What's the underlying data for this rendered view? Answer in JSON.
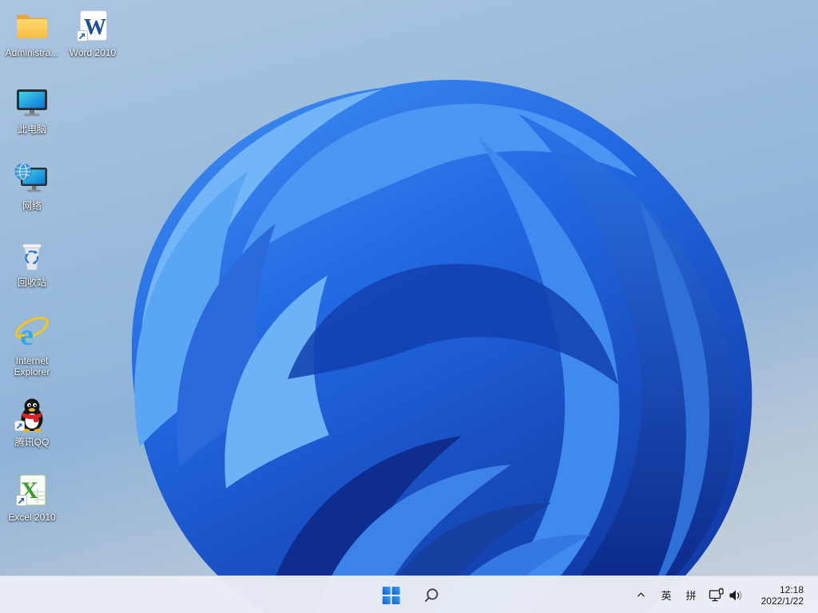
{
  "wallpaper": {
    "name": "windows-11-bloom",
    "bloom_primary": "#2268e2",
    "bloom_dark": "#0a2584",
    "bloom_light": "#72b5f8",
    "background_sky": "#9cbcdc"
  },
  "desktop": {
    "icons": [
      {
        "name": "administrator-folder",
        "label": "Administra..."
      },
      {
        "name": "word-2010",
        "label": "Word 2010"
      },
      {
        "name": "this-pc",
        "label": "此电脑"
      },
      {
        "name": "network",
        "label": "网络"
      },
      {
        "name": "recycle-bin",
        "label": "回收站"
      },
      {
        "name": "internet-explorer",
        "label": "Internet Explorer"
      },
      {
        "name": "tencent-qq",
        "label": "腾讯QQ"
      },
      {
        "name": "excel-2010",
        "label": "Excel 2010"
      }
    ]
  },
  "taskbar": {
    "tray": {
      "ime_lang": "英",
      "ime_mode": "拼"
    },
    "clock": {
      "time": "12:18",
      "date": "2022/1/22"
    }
  }
}
